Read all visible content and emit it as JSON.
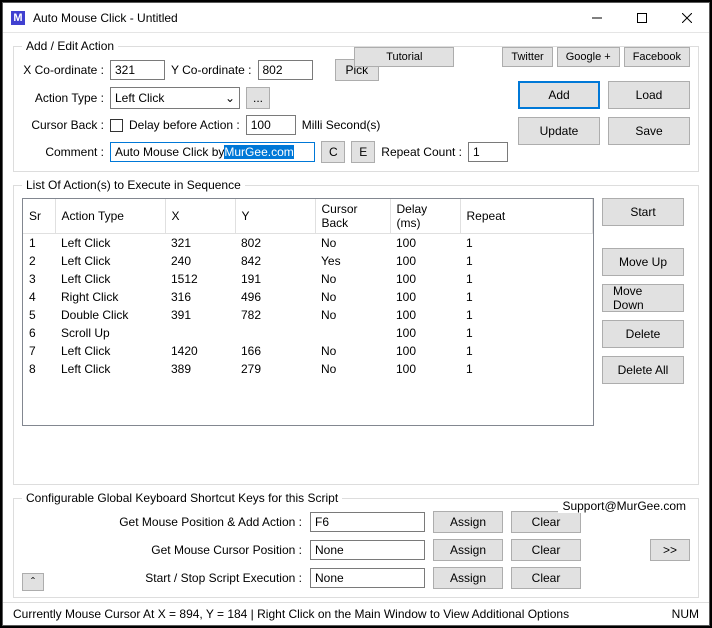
{
  "window": {
    "title": "Auto Mouse Click - Untitled"
  },
  "links": {
    "tutorial": "Tutorial",
    "twitter": "Twitter",
    "google": "Google +",
    "facebook": "Facebook"
  },
  "edit": {
    "legend": "Add / Edit Action",
    "xLabel": "X Co-ordinate :",
    "xValue": "321",
    "yLabel": "Y Co-ordinate :",
    "yValue": "802",
    "pick": "Pick",
    "actionTypeLabel": "Action Type :",
    "actionType": "Left Click",
    "dots": "...",
    "cursorBackLabel": "Cursor Back :",
    "delayLabel": "Delay before Action :",
    "delayValue": "100",
    "delayUnit": "Milli Second(s)",
    "commentLabel": "Comment :",
    "commentPlain": "Auto Mouse Click by ",
    "commentSel": "MurGee.com",
    "c": "C",
    "e": "E",
    "repeatLabel": "Repeat Count :",
    "repeatValue": "1",
    "add": "Add",
    "load": "Load",
    "update": "Update",
    "save": "Save"
  },
  "list": {
    "legend": "List Of Action(s) to Execute in Sequence",
    "headers": {
      "sr": "Sr",
      "type": "Action Type",
      "x": "X",
      "y": "Y",
      "cb": "Cursor Back",
      "delay": "Delay (ms)",
      "repeat": "Repeat"
    },
    "rows": [
      {
        "sr": "1",
        "type": "Left Click",
        "x": "321",
        "y": "802",
        "cb": "No",
        "delay": "100",
        "repeat": "1"
      },
      {
        "sr": "2",
        "type": "Left Click",
        "x": "240",
        "y": "842",
        "cb": "Yes",
        "delay": "100",
        "repeat": "1"
      },
      {
        "sr": "3",
        "type": "Left Click",
        "x": "1512",
        "y": "191",
        "cb": "No",
        "delay": "100",
        "repeat": "1"
      },
      {
        "sr": "4",
        "type": "Right Click",
        "x": "316",
        "y": "496",
        "cb": "No",
        "delay": "100",
        "repeat": "1"
      },
      {
        "sr": "5",
        "type": "Double Click",
        "x": "391",
        "y": "782",
        "cb": "No",
        "delay": "100",
        "repeat": "1"
      },
      {
        "sr": "6",
        "type": "Scroll Up",
        "x": "",
        "y": "",
        "cb": "",
        "delay": "100",
        "repeat": "1"
      },
      {
        "sr": "7",
        "type": "Left Click",
        "x": "1420",
        "y": "166",
        "cb": "No",
        "delay": "100",
        "repeat": "1"
      },
      {
        "sr": "8",
        "type": "Left Click",
        "x": "389",
        "y": "279",
        "cb": "No",
        "delay": "100",
        "repeat": "1"
      }
    ],
    "start": "Start",
    "moveUp": "Move Up",
    "moveDown": "Move Down",
    "delete": "Delete",
    "deleteAll": "Delete All"
  },
  "cfg": {
    "legend": "Configurable Global Keyboard Shortcut Keys for this Script",
    "support": "Support@MurGee.com",
    "r1": "Get Mouse Position & Add Action :",
    "v1": "F6",
    "r2": "Get Mouse Cursor Position :",
    "v2": "None",
    "r3": "Start / Stop Script Execution :",
    "v3": "None",
    "assign": "Assign",
    "clear": "Clear",
    "more": ">>",
    "collapse": "ˆ"
  },
  "status": {
    "msg": "Currently Mouse Cursor At X = 894, Y = 184 | Right Click on the Main Window to View Additional Options",
    "num": "NUM"
  }
}
